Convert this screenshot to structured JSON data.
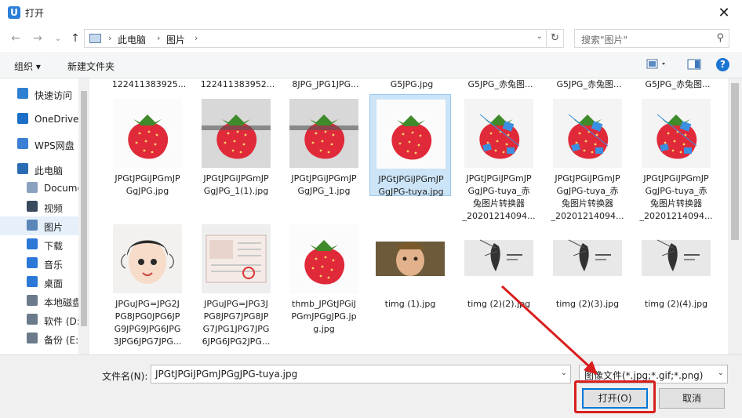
{
  "window": {
    "title": "打开",
    "app_icon": "U",
    "close": "✕"
  },
  "nav": {
    "back": "←",
    "forward": "→",
    "dropdown": "⌄",
    "up": "↑",
    "breadcrumb": [
      "此电脑",
      "图片"
    ],
    "separator": "›",
    "refresh": "↻",
    "search_placeholder": "搜索\"图片\""
  },
  "toolbar": {
    "organize": "组织",
    "new_folder": "新建文件夹",
    "organize_arrow": "▾"
  },
  "sidebar": [
    {
      "label": "快速访问",
      "icon": "star-icon",
      "color": "#2f80d1"
    },
    {
      "label": "OneDrive",
      "icon": "cloud-icon",
      "color": "#1b6fc7"
    },
    {
      "label": "WPS网盘",
      "icon": "cloud-icon",
      "color": "#3b7fd6"
    },
    {
      "label": "此电脑",
      "icon": "computer-icon",
      "color": "#2a6cb4"
    },
    {
      "label": "Docume",
      "icon": "document-icon",
      "color": "#8aa2bf"
    },
    {
      "label": "视频",
      "icon": "film-icon",
      "color": "#3a4a5e"
    },
    {
      "label": "图片",
      "icon": "picture-icon",
      "color": "#5a86b8"
    },
    {
      "label": "下载",
      "icon": "download-icon",
      "color": "#2b78d6"
    },
    {
      "label": "音乐",
      "icon": "music-icon",
      "color": "#2b78d6"
    },
    {
      "label": "桌面",
      "icon": "desktop-icon",
      "color": "#2b78d6"
    },
    {
      "label": "本地磁盘",
      "icon": "drive-icon",
      "color": "#6b7b8c"
    },
    {
      "label": "软件 (D:",
      "icon": "drive-icon",
      "color": "#6b7b8c"
    },
    {
      "label": "备份 (E:)",
      "icon": "drive-icon",
      "color": "#6b7b8c"
    }
  ],
  "files_top_row": [
    "122411383925...",
    "122411383952...",
    "8JPG_JPG1JPG...",
    "G5JPG.jpg",
    "G5JPG_赤兔图...",
    "G5JPG_赤兔图...",
    "G5JPG_赤兔图..."
  ],
  "files_row1": [
    {
      "lines": [
        "JPGtJPGiJPGmJP",
        "GgJPG.jpg"
      ],
      "thumb": "strawberry",
      "selected": false
    },
    {
      "lines": [
        "JPGtJPGiJPGmJP",
        "GgJPG_1(1).jpg"
      ],
      "thumb": "strawberry-watermark",
      "selected": false
    },
    {
      "lines": [
        "JPGtJPGiJPGmJP",
        "GgJPG_1.jpg"
      ],
      "thumb": "strawberry-watermark",
      "selected": false
    },
    {
      "lines": [
        "JPGtJPGiJPGmJP",
        "GgJPG-tuya.jpg"
      ],
      "thumb": "strawberry",
      "selected": true
    },
    {
      "lines": [
        "JPGtJPGiJPGmJP",
        "GgJPG-tuya_赤",
        "兔图片转换器",
        "_20201214094..."
      ],
      "thumb": "strawberry-doodle",
      "selected": false
    },
    {
      "lines": [
        "JPGtJPGiJPGmJP",
        "GgJPG-tuya_赤",
        "兔图片转换器",
        "_20201214094..."
      ],
      "thumb": "strawberry-doodle",
      "selected": false
    },
    {
      "lines": [
        "JPGtJPGiJPGmJP",
        "GgJPG-tuya_赤",
        "兔图片转换器",
        "_20201214094..."
      ],
      "thumb": "strawberry-doodle",
      "selected": false
    }
  ],
  "files_row2": [
    {
      "lines": [
        "JPGuJPG=JPG2J",
        "PG8JPG0JPG6JP",
        "G9JPG9JPG6JPG",
        "3JPG6JPG7JPG..."
      ],
      "thumb": "cartoon-girl"
    },
    {
      "lines": [
        "JPGuJPG=JPG3J",
        "PG8JPG7JPG8JP",
        "G7JPG1JPG7JPG",
        "6JPG6JPG2JPG..."
      ],
      "thumb": "certificate"
    },
    {
      "lines": [
        "thmb_JPGtJPGiJ",
        "PGmJPGgJPG.jp",
        "g.jpg"
      ],
      "thumb": "strawberry"
    },
    {
      "lines": [
        "timg (1).jpg"
      ],
      "thumb": "child-photo"
    },
    {
      "lines": [
        "timg (2)(2).jpg"
      ],
      "thumb": "banner"
    },
    {
      "lines": [
        "timg (2)(3).jpg"
      ],
      "thumb": "banner"
    },
    {
      "lines": [
        "timg (2)(4).jpg"
      ],
      "thumb": "banner"
    }
  ],
  "bottom": {
    "filename_label": "文件名(N):",
    "filename_value": "JPGtJPGiJPGmJPGgJPG-tuya.jpg",
    "filetype_value": "图像文件(*.jpg;*.gif;*.png)",
    "open_button": "打开(O)",
    "cancel_button": "取消"
  },
  "colors": {
    "selection": "#cce4f7",
    "accent": "#0078d7",
    "annotation": "#d91e1e"
  }
}
